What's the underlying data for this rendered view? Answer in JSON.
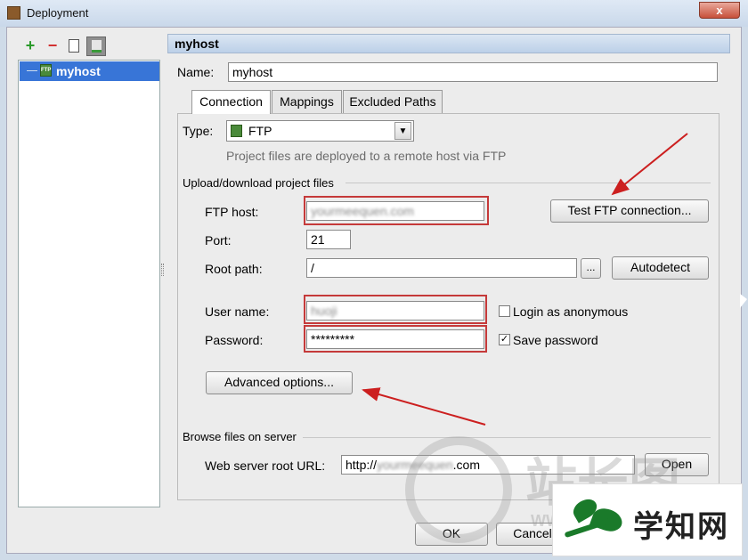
{
  "window": {
    "title": "Deployment",
    "close_label": "x"
  },
  "toolbar": {
    "add": "+",
    "remove": "−"
  },
  "sidebar": {
    "items": [
      {
        "label": "myhost",
        "badge": "FTP"
      }
    ]
  },
  "header": {
    "title": "myhost"
  },
  "name": {
    "label": "Name:",
    "value": "myhost"
  },
  "tabs": [
    {
      "label": "Connection"
    },
    {
      "label": "Mappings"
    },
    {
      "label": "Excluded Paths"
    }
  ],
  "type": {
    "label": "Type:",
    "value": "FTP",
    "hint": "Project files are deployed to a remote host via FTP"
  },
  "upload": {
    "section_title": "Upload/download project files",
    "ftp_host_label": "FTP host:",
    "ftp_host_value": "yourmeequen.com",
    "test_button": "Test FTP connection...",
    "port_label": "Port:",
    "port_value": "21",
    "root_path_label": "Root path:",
    "root_path_value": "/",
    "browse_button": "...",
    "autodetect_button": "Autodetect",
    "user_label": "User name:",
    "user_value": "huoji",
    "login_anon_label": "Login as anonymous",
    "login_anon_checked": false,
    "password_label": "Password:",
    "password_value": "*********",
    "save_password_label": "Save password",
    "save_password_checked": true,
    "advanced_button": "Advanced options..."
  },
  "browse": {
    "section_title": "Browse files on server",
    "url_label": "Web server root URL:",
    "url_prefix": "http://",
    "url_blur": "yourmeequen",
    "url_suffix": ".com",
    "open_button": "Open"
  },
  "footer": {
    "ok_button": "OK",
    "cancel_button": "Cancel"
  },
  "watermark": {
    "cn_text": "站长图",
    "url_text": "WWW",
    "logo_text": "学知网"
  },
  "colors": {
    "selection": "#3875d7",
    "highlight_box": "#c53a3a",
    "arrow": "#cc1f1f"
  }
}
